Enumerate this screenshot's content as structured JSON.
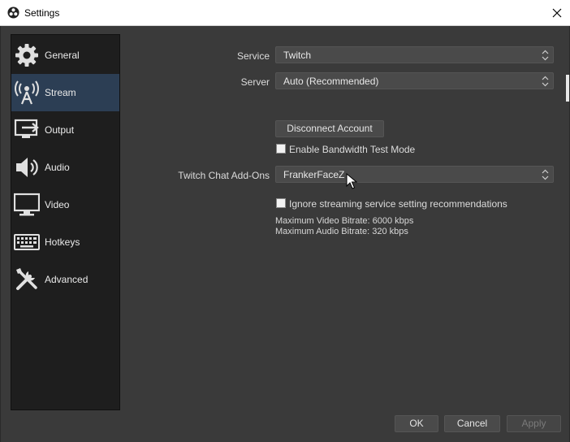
{
  "window": {
    "title": "Settings"
  },
  "sidebar": {
    "items": [
      {
        "label": "General",
        "icon": "gear-icon"
      },
      {
        "label": "Stream",
        "icon": "broadcast-icon"
      },
      {
        "label": "Output",
        "icon": "output-icon"
      },
      {
        "label": "Audio",
        "icon": "speaker-icon"
      },
      {
        "label": "Video",
        "icon": "monitor-icon"
      },
      {
        "label": "Hotkeys",
        "icon": "keyboard-icon"
      },
      {
        "label": "Advanced",
        "icon": "tools-icon"
      }
    ],
    "active": "Stream"
  },
  "stream": {
    "service_label": "Service",
    "service_value": "Twitch",
    "server_label": "Server",
    "server_value": "Auto (Recommended)",
    "disconnect_label": "Disconnect Account",
    "bandwidth_label": "Enable Bandwidth Test Mode",
    "bandwidth_checked": false,
    "addons_label": "Twitch Chat Add-Ons",
    "addons_value": "FrankerFaceZ",
    "ignore_label": "Ignore streaming service setting recommendations",
    "ignore_checked": false,
    "max_video": "Maximum Video Bitrate: 6000 kbps",
    "max_audio": "Maximum Audio Bitrate: 320 kbps"
  },
  "footer": {
    "ok_label": "OK",
    "cancel_label": "Cancel",
    "apply_label": "Apply"
  },
  "colors": {
    "sidebar_active": "#2c3e54",
    "background": "#3a3a3a",
    "sidebar_bg": "#1e1e1e"
  }
}
